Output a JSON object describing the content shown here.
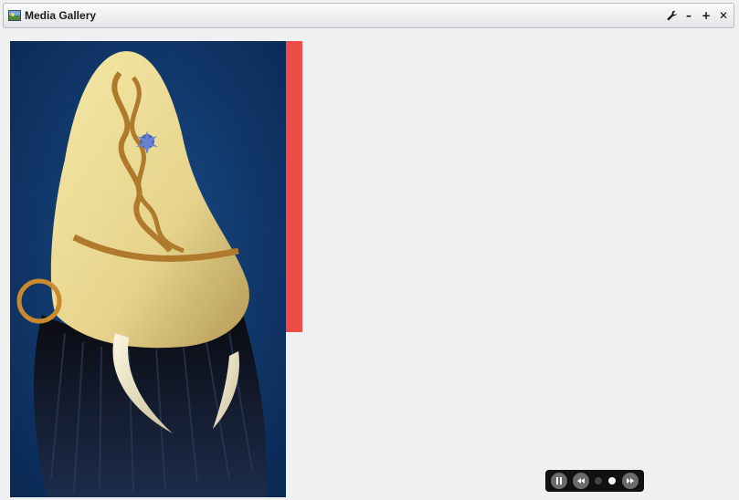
{
  "window": {
    "title": "Media Gallery",
    "app_icon": "gallery-icon",
    "controls": {
      "settings_icon": "wrench-icon",
      "minimize_glyph": "–",
      "maximize_glyph": "+",
      "close_glyph": "✕"
    }
  },
  "gallery": {
    "colors": {
      "image_background": "#0d3463",
      "accent_bar": "#ef4b48"
    },
    "slideshow": {
      "pause_icon": "pause-icon",
      "prev_icon": "rewind-icon",
      "next_icon": "fast-forward-icon",
      "slide_count": 2,
      "active_slide": 2
    }
  }
}
